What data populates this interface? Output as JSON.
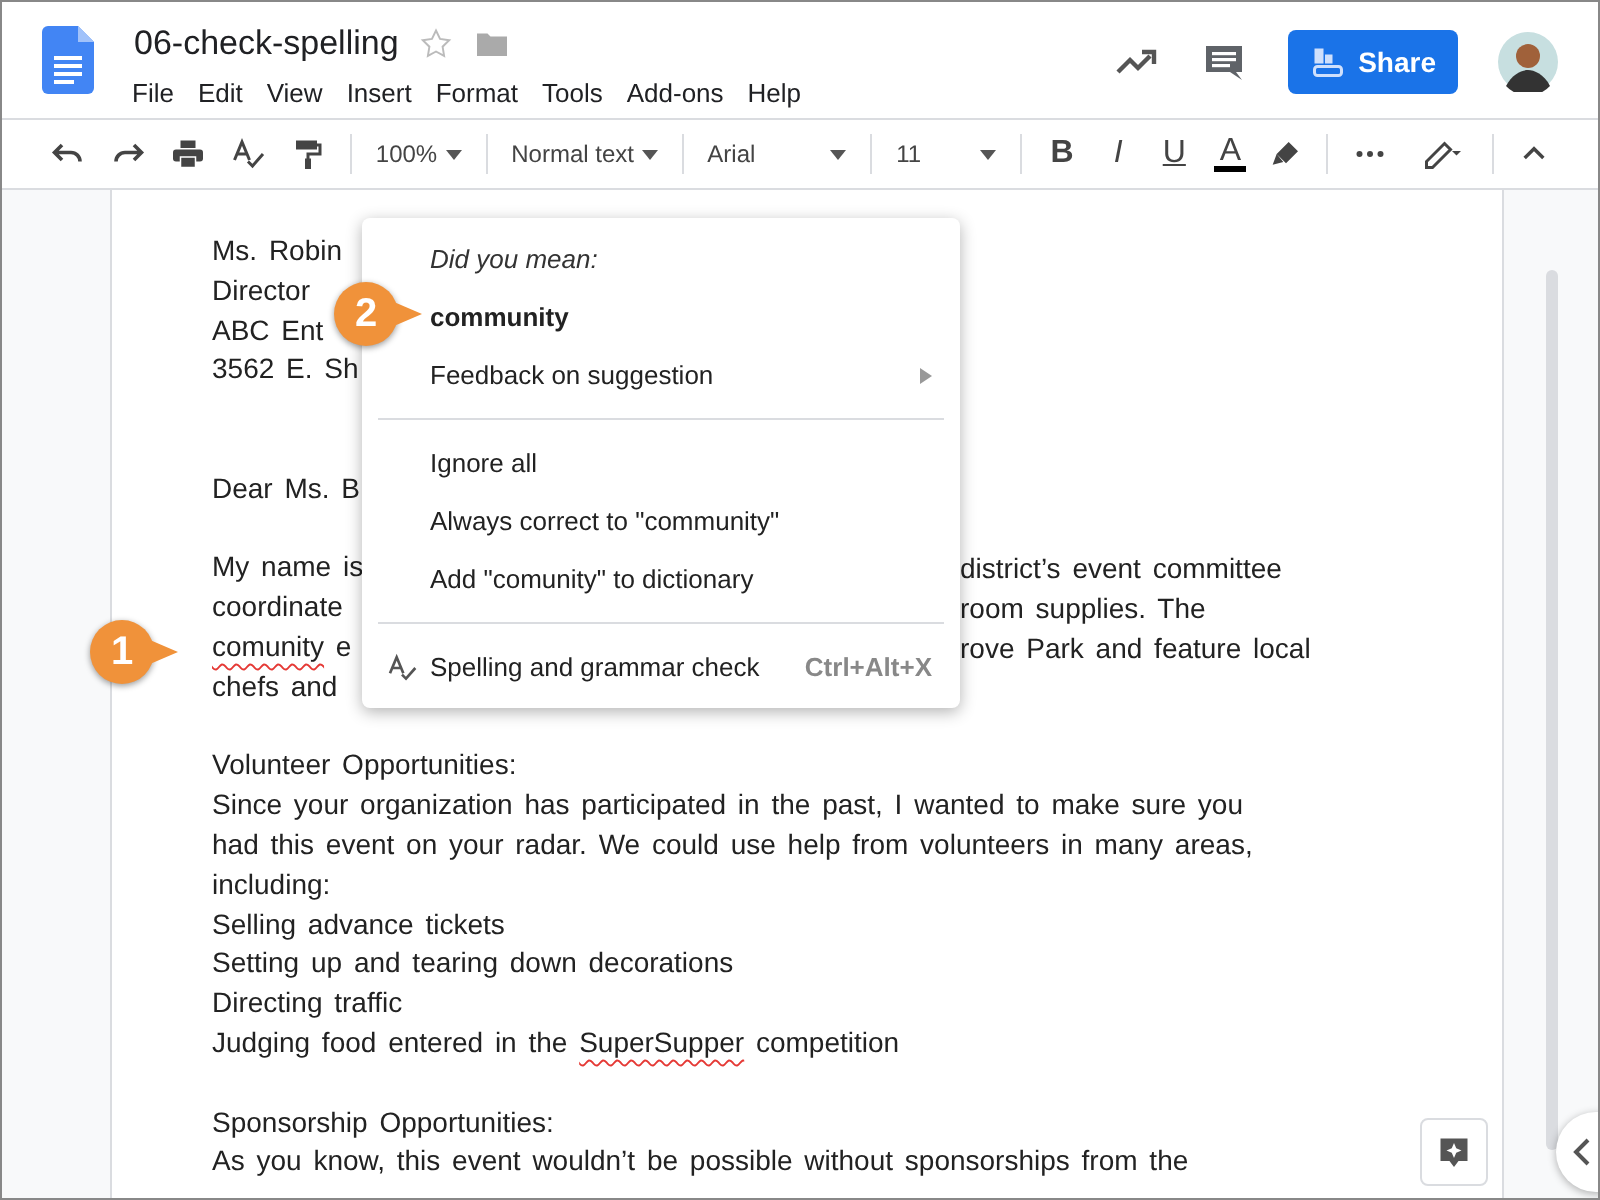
{
  "document": {
    "title": "06-check-spelling",
    "starred": false
  },
  "menu_bar": [
    "File",
    "Edit",
    "View",
    "Insert",
    "Format",
    "Tools",
    "Add-ons",
    "Help"
  ],
  "share_button": "Share",
  "toolbar": {
    "zoom": "100%",
    "style": "Normal text",
    "font": "Arial",
    "size": "11",
    "format_buttons": [
      "B",
      "I",
      "U",
      "A"
    ]
  },
  "paragraphs": [
    {
      "kind": "address",
      "lines": [
        {
          "left": [
            {
              "text": "Ms. Robin",
              "misspelled": false
            }
          ]
        },
        {
          "left": [
            {
              "text": "Director",
              "misspelled": false
            }
          ]
        },
        {
          "left": [
            {
              "text": "ABC Ent",
              "misspelled": false
            }
          ]
        },
        {
          "left": [
            {
              "text": "3562 E. Sh",
              "misspelled": false
            }
          ]
        }
      ]
    },
    {
      "kind": "body",
      "lines": [
        {
          "left": [
            {
              "text": "Dear Ms. B",
              "misspelled": false
            }
          ]
        }
      ]
    },
    {
      "kind": "body",
      "lines": [
        {
          "left": [
            {
              "text": "My name is",
              "misspelled": false
            }
          ],
          "right": "district’s event committee"
        },
        {
          "left": [
            {
              "text": "coordinate",
              "misspelled": false
            }
          ],
          "right": "room supplies. The"
        },
        {
          "left": [
            {
              "text": "comunity",
              "misspelled": true
            },
            {
              "text": " e",
              "misspelled": false
            }
          ],
          "right": "rove Park and feature local"
        },
        {
          "left": [
            {
              "text": "chefs and",
              "misspelled": false
            }
          ]
        }
      ]
    },
    {
      "kind": "body",
      "lines": [
        {
          "left": [
            {
              "text": "Volunteer Opportunities:",
              "misspelled": false
            }
          ]
        },
        {
          "left": [
            {
              "text": "Since your organization has participated in the past, I wanted to make sure you",
              "misspelled": false
            }
          ]
        },
        {
          "left": [
            {
              "text": "had this event on your radar. We could use help from volunteers in many areas,",
              "misspelled": false
            }
          ]
        },
        {
          "left": [
            {
              "text": "including:",
              "misspelled": false
            }
          ]
        },
        {
          "left": [
            {
              "text": "Selling advance tickets",
              "misspelled": false
            }
          ]
        },
        {
          "left": [
            {
              "text": "Setting up and tearing down decorations",
              "misspelled": false
            }
          ]
        },
        {
          "left": [
            {
              "text": "Directing traffic",
              "misspelled": false
            }
          ]
        },
        {
          "left": [
            {
              "text": "Judging food entered in the ",
              "misspelled": false
            },
            {
              "text": "SuperSupper",
              "misspelled": true
            },
            {
              "text": " competition",
              "misspelled": false
            }
          ]
        }
      ]
    },
    {
      "kind": "body",
      "lines": [
        {
          "left": [
            {
              "text": "Sponsorship Opportunities:",
              "misspelled": false
            }
          ]
        },
        {
          "left": [
            {
              "text": "As you know, this event wouldn’t be possible without sponsorships from the",
              "misspelled": false
            }
          ]
        }
      ]
    }
  ],
  "context_menu": [
    {
      "kind": "heading",
      "label": "Did you mean:"
    },
    {
      "kind": "suggestion",
      "label": "community"
    },
    {
      "kind": "submenu",
      "label": "Feedback on suggestion"
    },
    {
      "kind": "divider"
    },
    {
      "kind": "item",
      "label": "Ignore all"
    },
    {
      "kind": "item",
      "label": "Always correct to \"community\""
    },
    {
      "kind": "item",
      "label": "Add \"comunity\" to dictionary"
    },
    {
      "kind": "divider"
    },
    {
      "kind": "tool",
      "label": "Spelling and grammar check",
      "shortcut": "Ctrl+Alt+X"
    }
  ],
  "callouts": [
    "1",
    "2"
  ]
}
